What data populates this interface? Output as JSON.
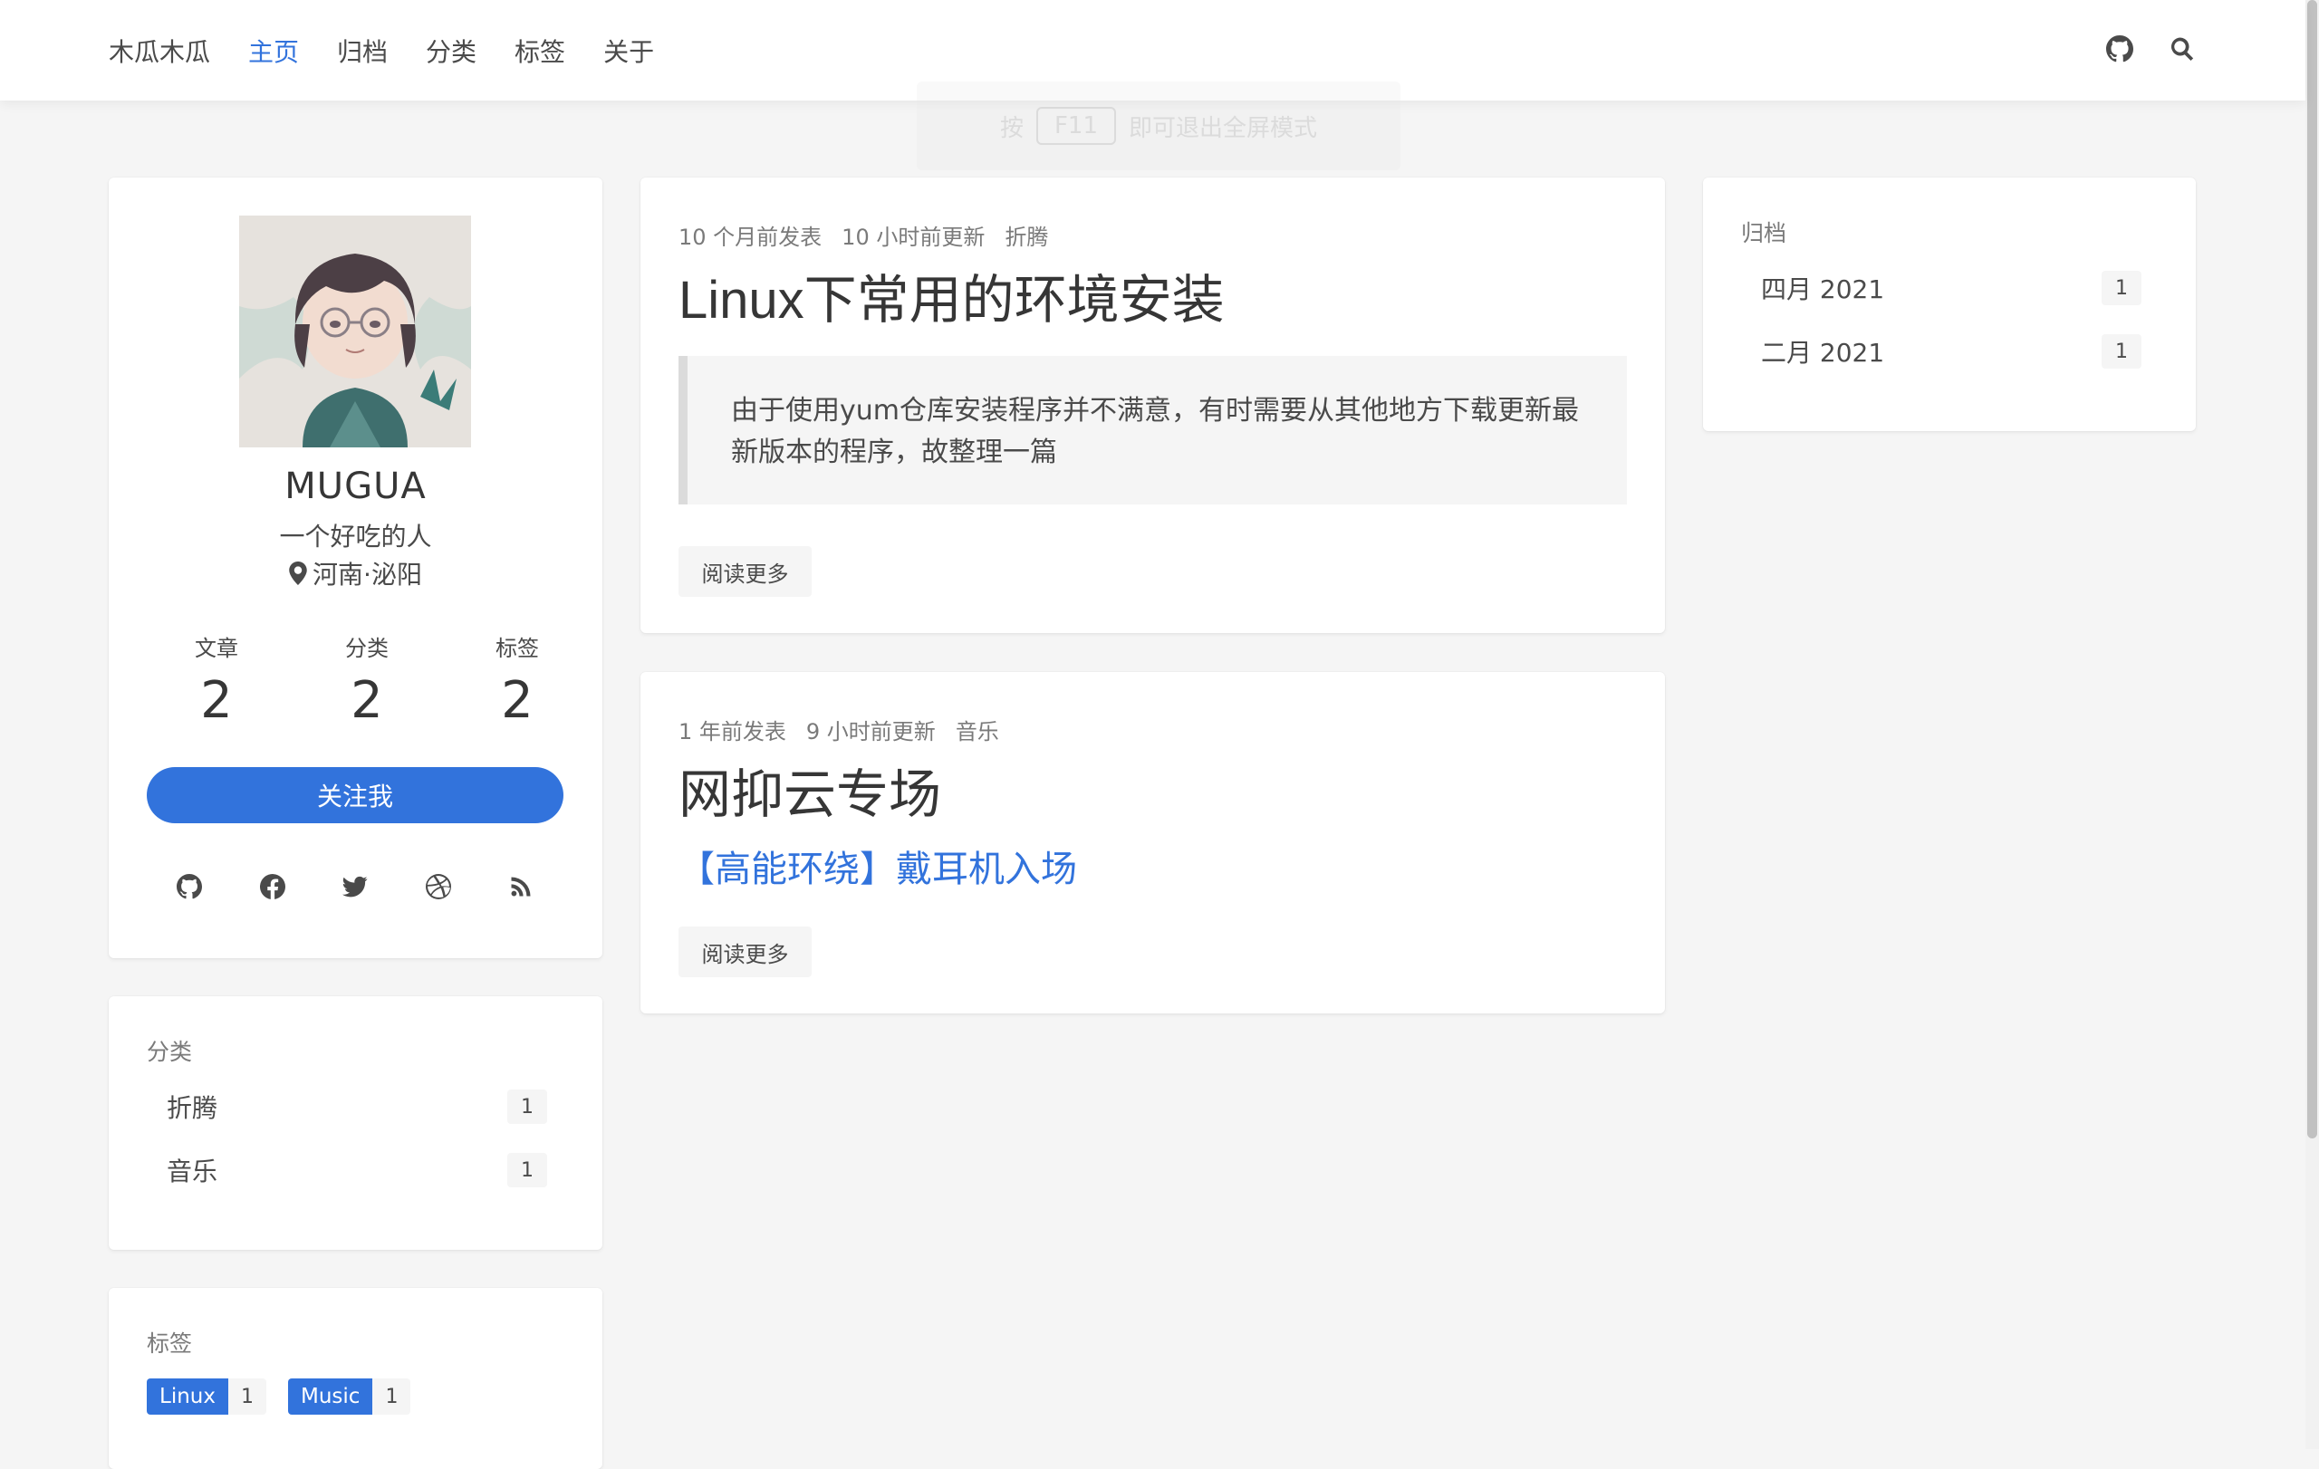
{
  "navbar": {
    "brand": "木瓜木瓜",
    "items": [
      {
        "label": "主页",
        "active": true
      },
      {
        "label": "归档",
        "active": false
      },
      {
        "label": "分类",
        "active": false
      },
      {
        "label": "标签",
        "active": false
      },
      {
        "label": "关于",
        "active": false
      }
    ],
    "icons": [
      "github-icon",
      "search-icon"
    ]
  },
  "fullscreen_hint": {
    "prefix": "按",
    "key": "F11",
    "suffix": "即可退出全屏模式"
  },
  "profile": {
    "name": "MUGUA",
    "bio": "一个好吃的人",
    "location": "河南·泌阳",
    "stats": [
      {
        "label": "文章",
        "value": "2"
      },
      {
        "label": "分类",
        "value": "2"
      },
      {
        "label": "标签",
        "value": "2"
      }
    ],
    "follow_label": "关注我",
    "socials": [
      "github-icon",
      "facebook-icon",
      "twitter-icon",
      "dribbble-icon",
      "rss-icon"
    ]
  },
  "categories": {
    "title": "分类",
    "items": [
      {
        "label": "折腾",
        "count": "1"
      },
      {
        "label": "音乐",
        "count": "1"
      }
    ]
  },
  "tags": {
    "title": "标签",
    "items": [
      {
        "label": "Linux",
        "count": "1"
      },
      {
        "label": "Music",
        "count": "1"
      }
    ]
  },
  "archives": {
    "title": "归档",
    "items": [
      {
        "label": "四月 2021",
        "count": "1"
      },
      {
        "label": "二月 2021",
        "count": "1"
      }
    ]
  },
  "posts": [
    {
      "published": "10 个月前发表",
      "updated": "10 小时前更新",
      "category": "折腾",
      "title": "Linux下常用的环境安装",
      "excerpt": "由于使用yum仓库安装程序并不满意，有时需要从其他地方下载更新最新版本的程序，故整理一篇",
      "read_more": "阅读更多"
    },
    {
      "published": "1 年前发表",
      "updated": "9 小时前更新",
      "category": "音乐",
      "title": "网抑云专场",
      "link": "【高能环绕】戴耳机入场",
      "read_more": "阅读更多"
    }
  ],
  "colors": {
    "accent": "#3273dc",
    "background": "#f5f5f5",
    "card": "#ffffff",
    "text": "#363636",
    "muted": "#7a7a7a"
  }
}
